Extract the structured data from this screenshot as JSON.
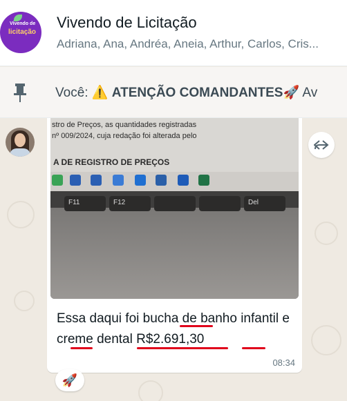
{
  "header": {
    "group_name": "Vivendo de Licitação",
    "members": "Adriana, Ana, Andréa, Aneia, Arthur, Carlos, Cris...",
    "avatar_logo": {
      "line1": "Vivendo de",
      "line2": "licitação"
    }
  },
  "pinned": {
    "sender": "Você:",
    "emoji_warning": "⚠️",
    "title": "ATENÇÃO COMANDANTES",
    "emoji_rocket": "🚀",
    "trailing": "Av"
  },
  "message": {
    "photo": {
      "doc_line_1": "stro de Preços, as quantidades registradas",
      "doc_line_2": "nº 009/2024, cuja redação foi alterada pelo",
      "doc_heading": "A DE REGISTRO DE PREÇOS",
      "keys": [
        "F11",
        "F12",
        "",
        "",
        "Del"
      ]
    },
    "caption": "Essa daqui foi bucha de banho infantil e creme dental R$2.691,30",
    "time": "08:34",
    "reaction": "🚀"
  },
  "colors": {
    "chat_bg": "#efeae2",
    "bubble_bg": "#ffffff",
    "accent_purple": "#7b2cbf",
    "underline_red": "#e0001a"
  },
  "icons": [
    "pin-icon",
    "forward-icon"
  ]
}
